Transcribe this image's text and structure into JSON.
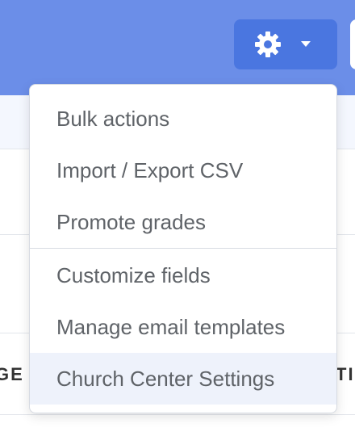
{
  "header": {
    "settings_button": {
      "icon": "gear-icon",
      "caret": "caret-down-icon",
      "color": "#4a76e0"
    },
    "band_color": "#6b8ee8"
  },
  "table": {
    "column_headers": [
      "GE",
      "TI"
    ]
  },
  "dropdown_menu": {
    "groups": [
      {
        "items": [
          {
            "label": "Bulk actions"
          },
          {
            "label": "Import / Export CSV"
          },
          {
            "label": "Promote grades"
          }
        ]
      },
      {
        "items": [
          {
            "label": "Customize fields"
          },
          {
            "label": "Manage email templates"
          },
          {
            "label": "Church Center Settings",
            "highlighted": true
          }
        ]
      }
    ]
  }
}
